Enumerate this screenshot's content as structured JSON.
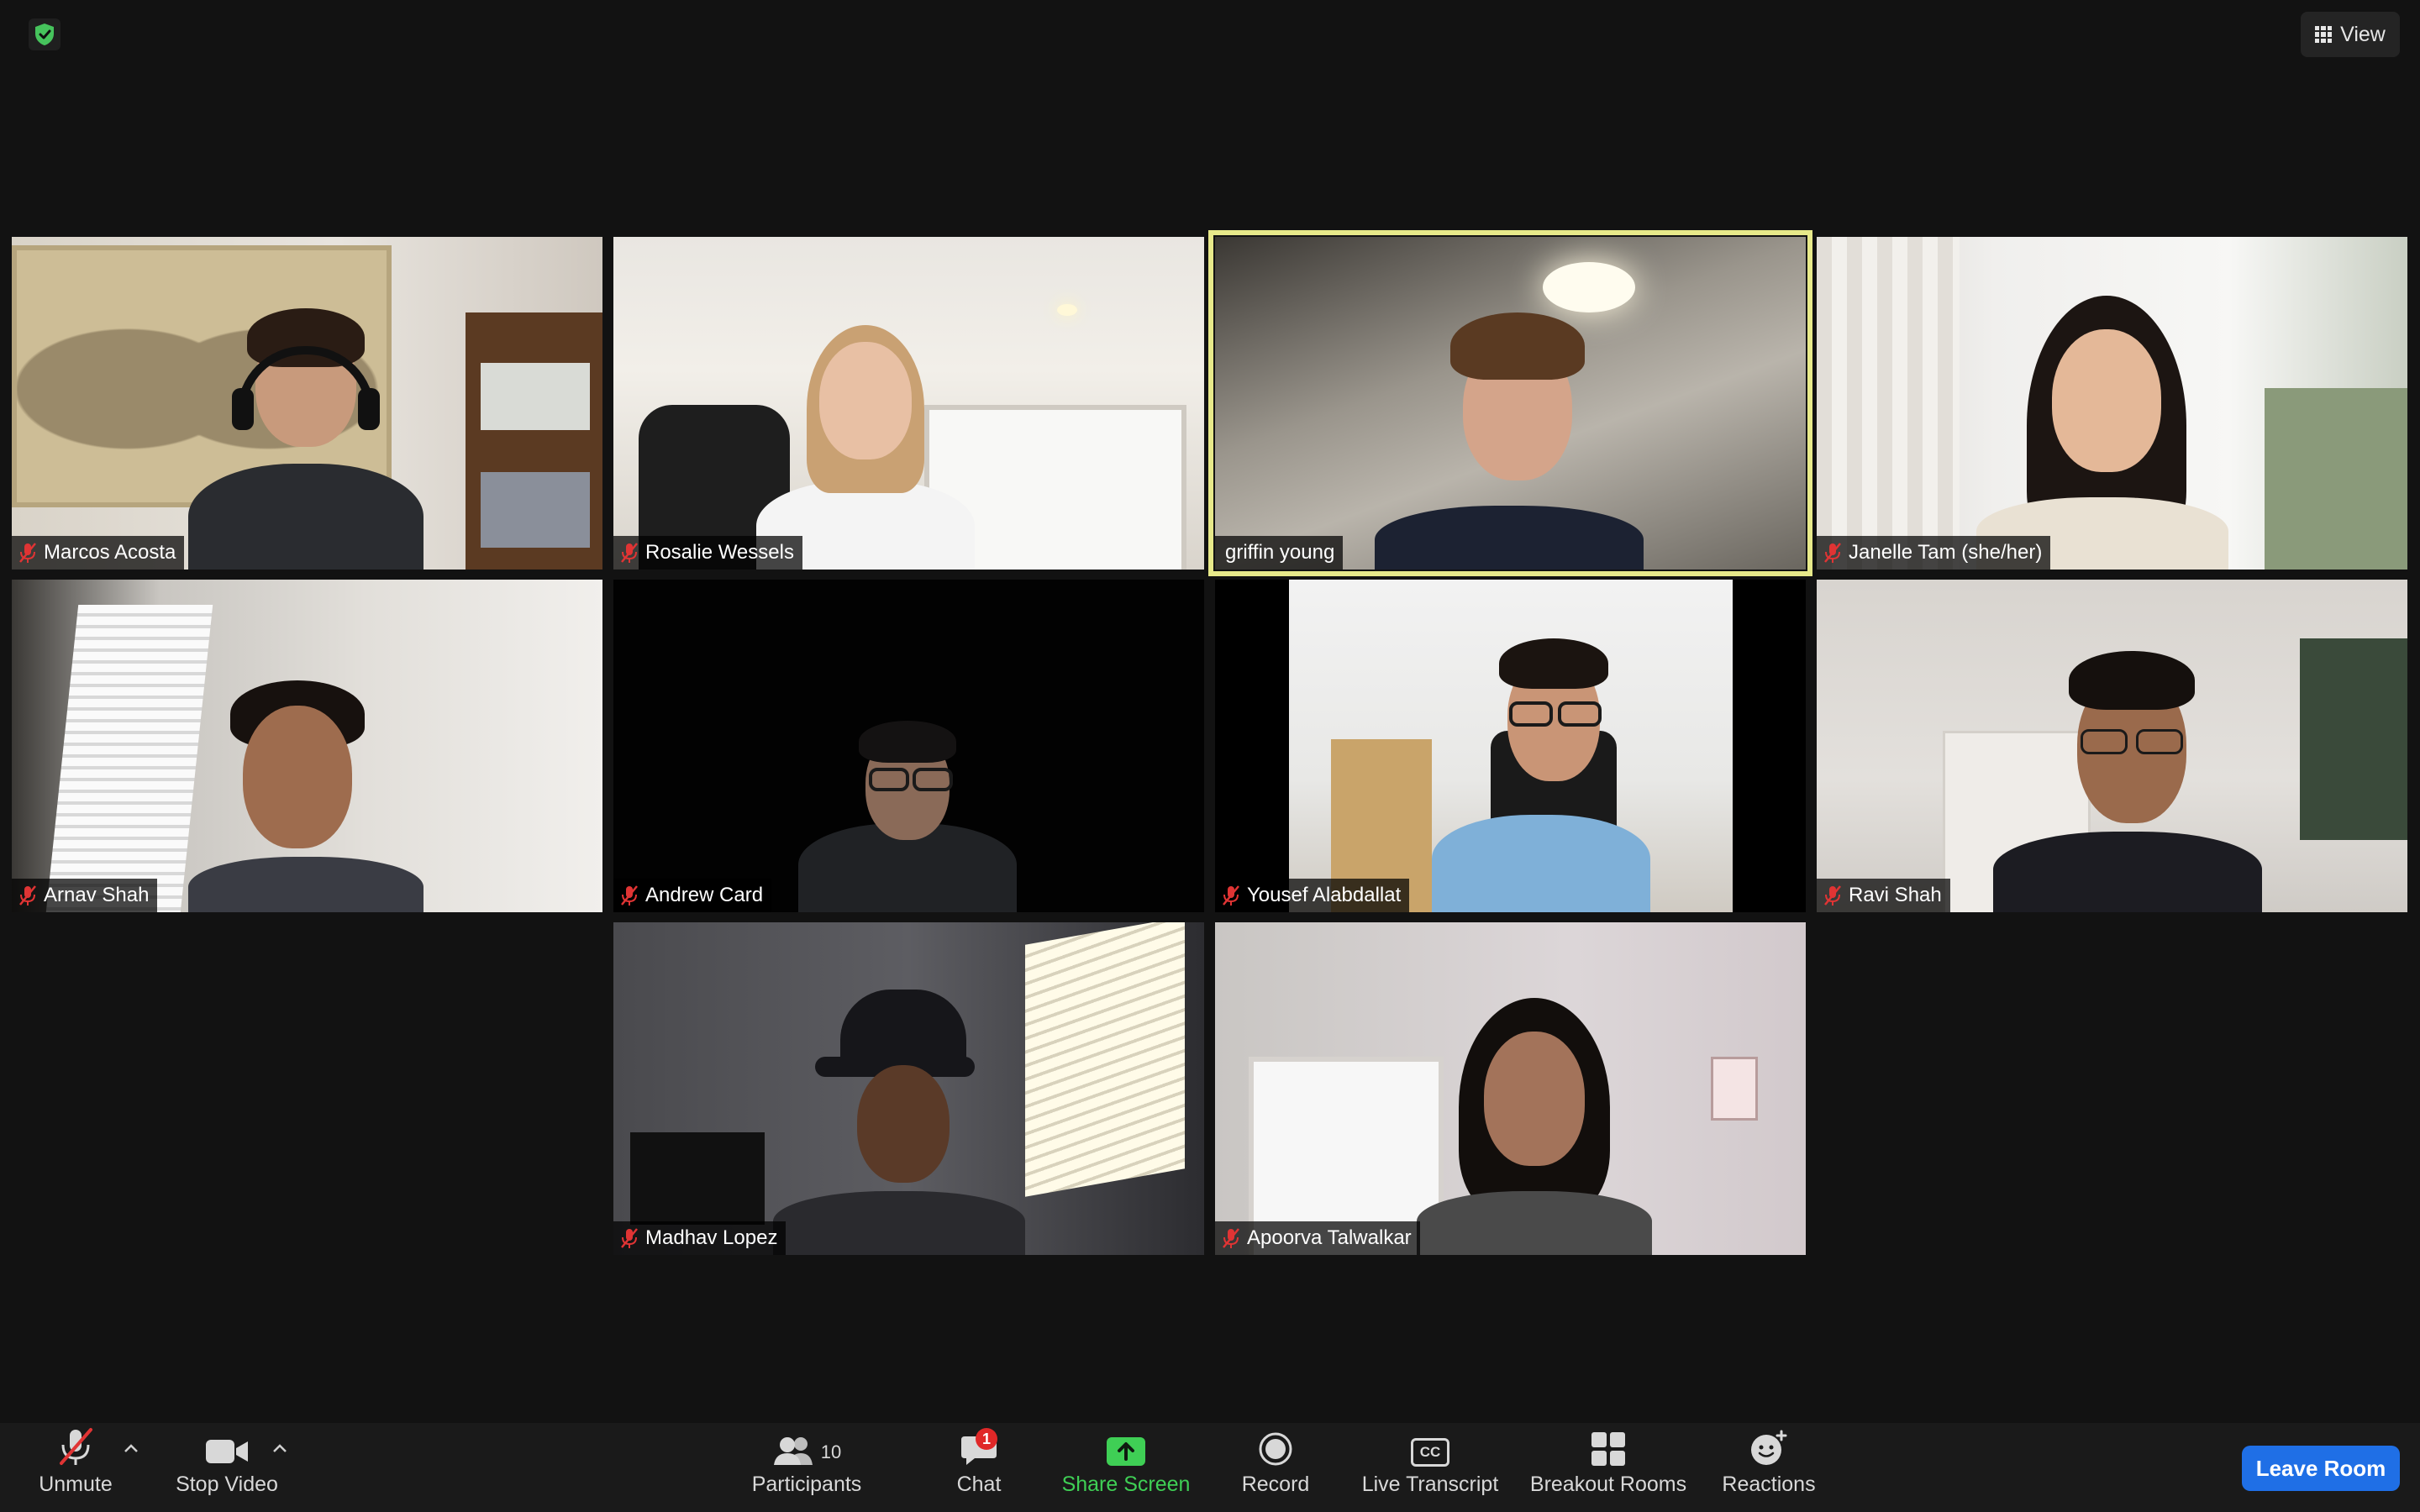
{
  "header": {
    "view_label": "View",
    "shield_color": "#46c35c"
  },
  "participants": [
    {
      "name": "Marcos Acosta",
      "muted": true
    },
    {
      "name": "Rosalie Wessels",
      "muted": true
    },
    {
      "name": "griffin young",
      "muted": false,
      "active_speaker": true
    },
    {
      "name": "Janelle Tam (she/her)",
      "muted": true
    },
    {
      "name": "Arnav Shah",
      "muted": true
    },
    {
      "name": "Andrew Card",
      "muted": true
    },
    {
      "name": "Yousef Alabdallat",
      "muted": true
    },
    {
      "name": "Ravi Shah",
      "muted": true
    },
    {
      "name": "Madhav Lopez",
      "muted": true
    },
    {
      "name": "Apoorva Talwalkar",
      "muted": true
    }
  ],
  "toolbar": {
    "unmute_label": "Unmute",
    "stop_video_label": "Stop Video",
    "participants_label": "Participants",
    "participants_count": "10",
    "chat_label": "Chat",
    "chat_badge": "1",
    "share_screen_label": "Share Screen",
    "record_label": "Record",
    "live_transcript_label": "Live Transcript",
    "cc_glyph": "CC",
    "breakout_rooms_label": "Breakout Rooms",
    "reactions_label": "Reactions",
    "leave_label": "Leave Room",
    "share_color": "#3fcf55",
    "leave_color": "#1f6fe6",
    "active_speaker_color": "#e7e98a"
  }
}
